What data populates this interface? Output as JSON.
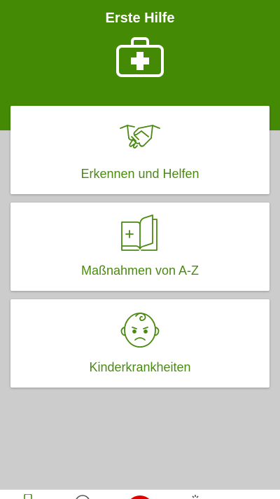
{
  "header": {
    "title": "Erste Hilfe",
    "icon": "first-aid-kit-icon"
  },
  "cards": [
    {
      "label": "Erkennen und Helfen",
      "icon": "handshake-icon"
    },
    {
      "label": "Maßnahmen von A-Z",
      "icon": "book-plus-icon"
    },
    {
      "label": "Kinderkrankheiten",
      "icon": "sad-baby-face-icon"
    }
  ],
  "bottom_nav": {
    "icons": [
      "phone-icon",
      "info-icon",
      "emergency-icon",
      "settings-icon"
    ]
  },
  "colors": {
    "header_bg": "#448a04",
    "accent": "#4a8a12",
    "page_bg": "#cccccc",
    "card_bg": "#ffffff",
    "emergency": "#e00000"
  }
}
